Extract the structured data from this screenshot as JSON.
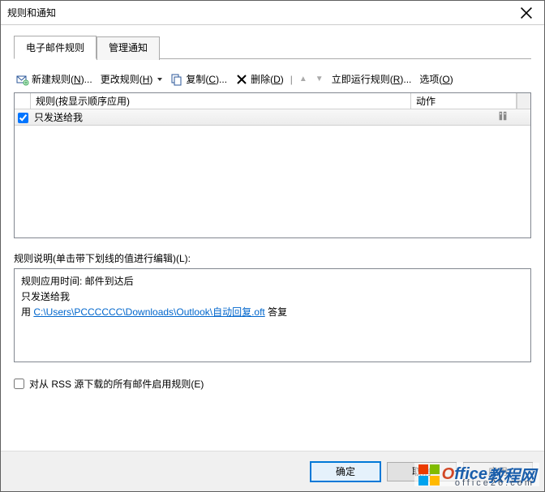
{
  "window": {
    "title": "规则和通知"
  },
  "tabs": {
    "email_rules": "电子邮件规则",
    "manage_alerts": "管理通知"
  },
  "toolbar": {
    "new_rule": "新建规则",
    "new_rule_key": "N",
    "change_rule": "更改规则",
    "change_rule_key": "H",
    "copy": "复制",
    "copy_key": "C",
    "delete": "删除",
    "delete_key": "D",
    "run_now": "立即运行规则",
    "run_now_key": "R",
    "options": "选项",
    "options_key": "O"
  },
  "table": {
    "col_rule": "规则(按显示顺序应用)",
    "col_action": "动作",
    "rows": [
      {
        "checked": true,
        "name": "只发送给我"
      }
    ]
  },
  "description": {
    "label": "规则说明(单击带下划线的值进行编辑)(L):",
    "line1": "规则应用时间: 邮件到达后",
    "line2": "只发送给我",
    "line3_prefix": "用 ",
    "line3_link": "C:\\Users\\PCCCCCC\\Downloads\\Outlook\\自动回复.oft",
    "line3_suffix": " 答复"
  },
  "rss": {
    "label": "对从 RSS 源下载的所有邮件启用规则(E)",
    "checked": false
  },
  "buttons": {
    "ok": "确定",
    "cancel": "取消",
    "apply": "应用"
  },
  "watermark": {
    "brand_o": "O",
    "brand_rest": "ffice",
    "brand_cn": "教程网",
    "sub": "office26.com"
  }
}
